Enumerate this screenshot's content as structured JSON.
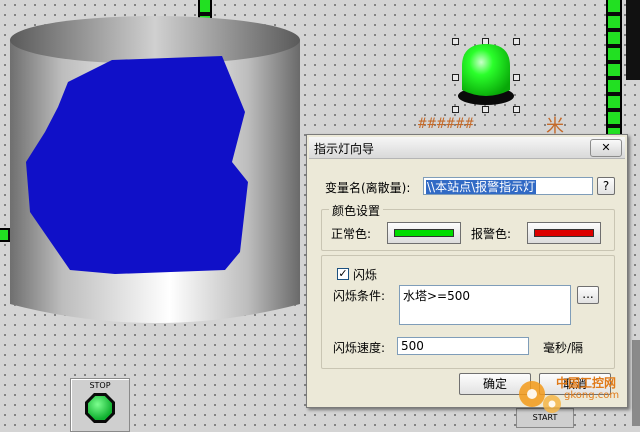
{
  "canvas": {
    "indicator_placeholder": "######",
    "unit_label": "米",
    "stop_button_label": "STOP",
    "start_button_label": "START"
  },
  "dialog": {
    "title": "指示灯向导",
    "close_glyph": "✕",
    "variable_label": "变量名(离散量):",
    "variable_value": "\\\\本站点\\报警指示灯",
    "browse_button": "?",
    "color_group_title": "颜色设置",
    "normal_color_label": "正常色:",
    "normal_color": "#00dd00",
    "alarm_color_label": "报警色:",
    "alarm_color": "#dd0000",
    "blink_checkbox_label": "闪烁",
    "blink_checked": true,
    "blink_condition_label": "闪烁条件:",
    "blink_condition_value": "水塔>=500",
    "condition_browse_button": "...",
    "blink_speed_label": "闪烁速度:",
    "blink_speed_value": "500",
    "blink_speed_unit": "毫秒/隔",
    "ok_button": "确定",
    "cancel_button": "取消"
  },
  "watermark": {
    "text_top": "中国工控网",
    "text_bottom": "gkong.com"
  },
  "colors": {
    "tank_liquid": "#1010c8",
    "lamp_green": "#19ff19",
    "pipe_green": "#22e022"
  }
}
